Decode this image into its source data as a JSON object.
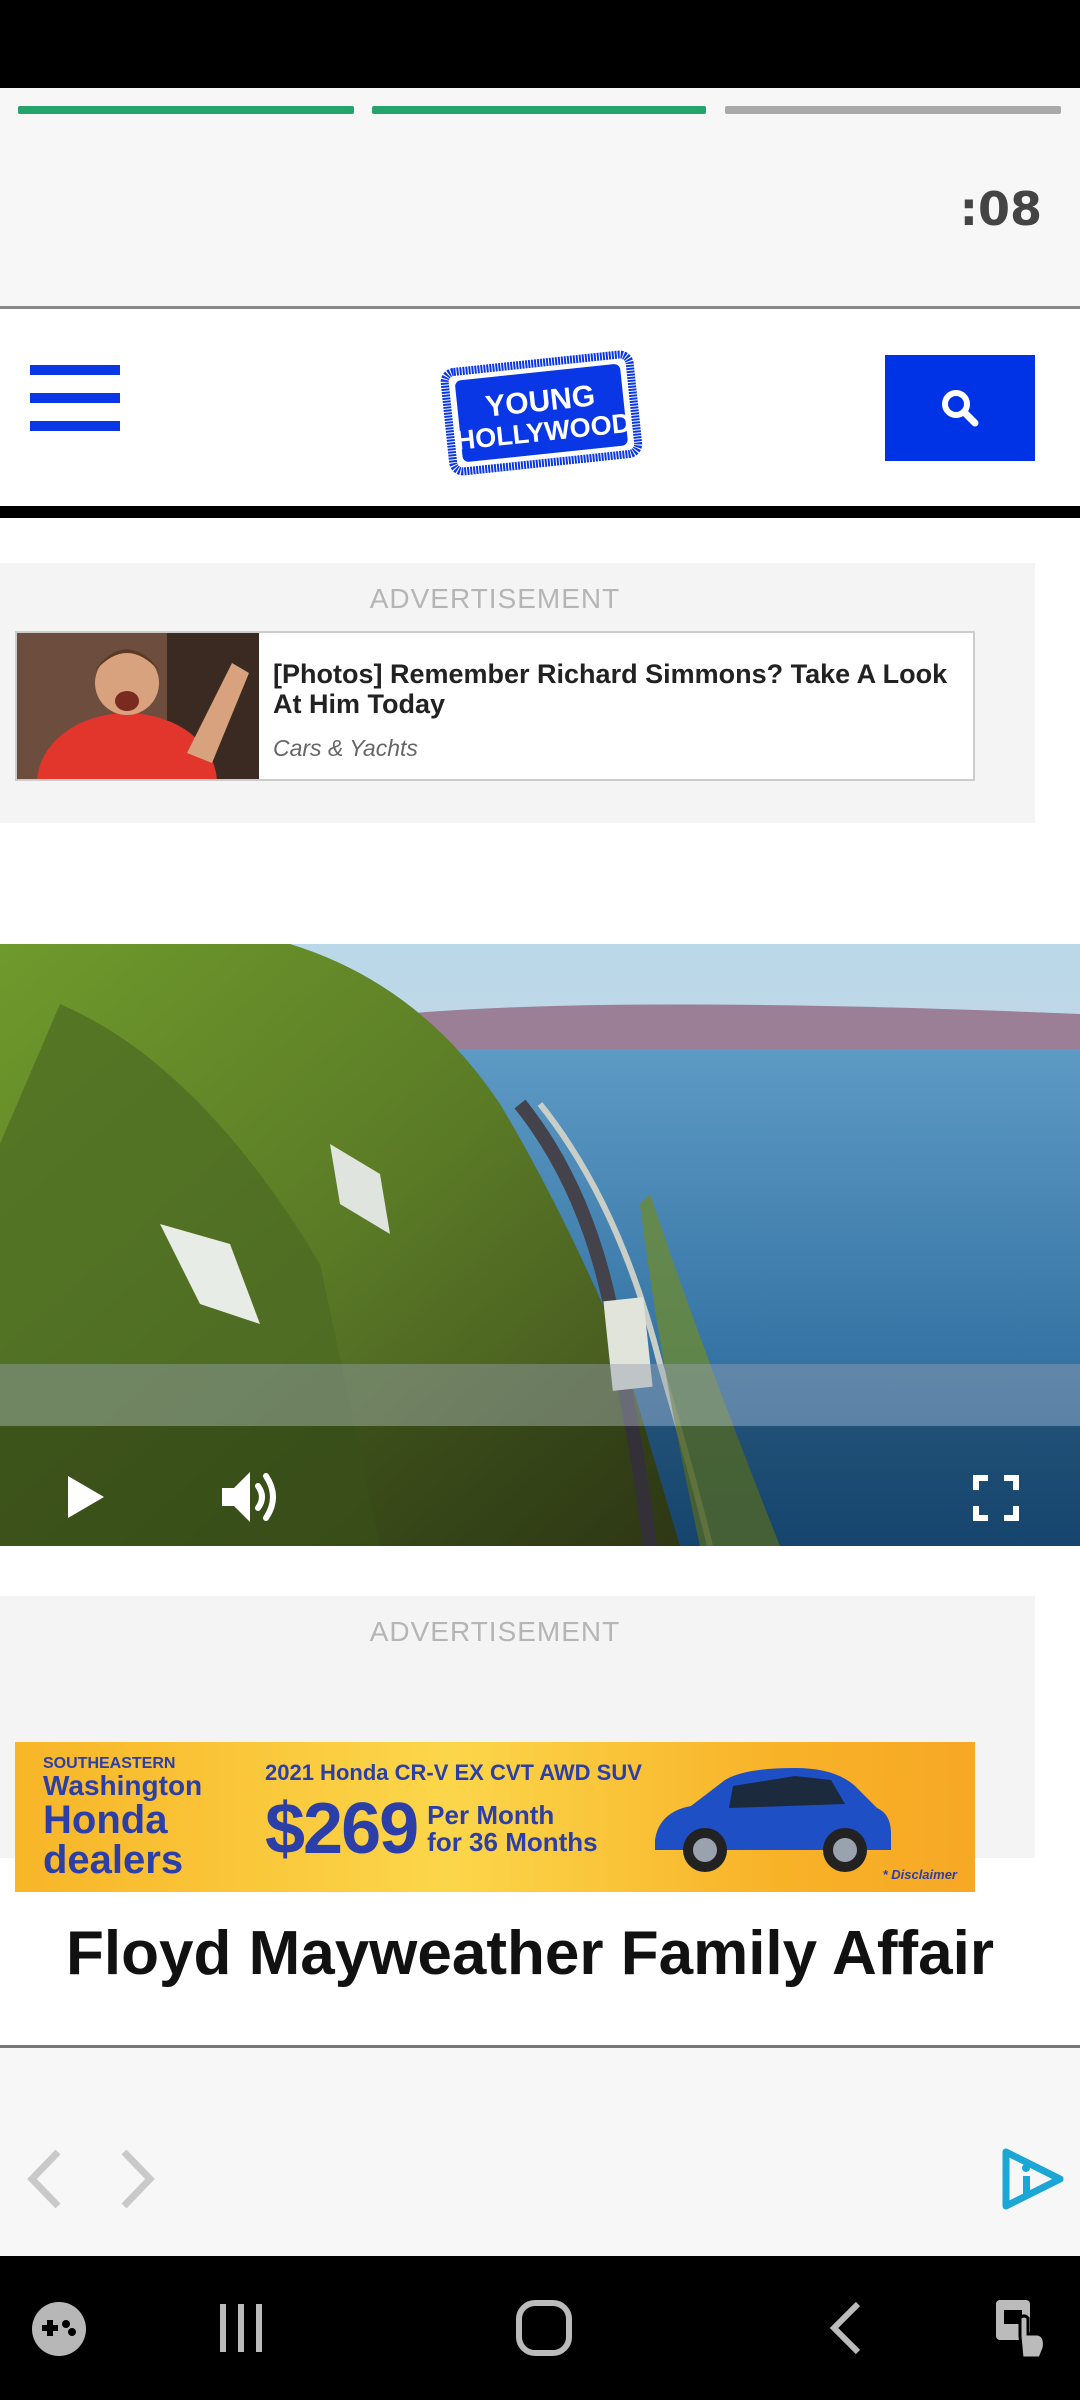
{
  "story": {
    "timer": ":08",
    "segments": [
      {
        "state": "watched",
        "color": "#24a36b"
      },
      {
        "state": "watched",
        "color": "#24a36b"
      },
      {
        "state": "pending",
        "color": "#a9a9a9"
      }
    ]
  },
  "header": {
    "logo_line1": "YOUNG",
    "logo_line2": "HOLLYWOOD",
    "brand_color": "#0a37e6",
    "menu_icon": "hamburger-menu-icon",
    "search_icon": "search-icon"
  },
  "ad1": {
    "label": "ADVERTISEMENT",
    "title": "[Photos] Remember Richard Simmons? Take A Look At Him Today",
    "source": "Cars & Yachts"
  },
  "video": {
    "controls": [
      "play-icon",
      "volume-icon",
      "fullscreen-icon"
    ]
  },
  "ad2": {
    "label": "ADVERTISEMENT",
    "brand_line1": "SOUTHEASTERN",
    "brand_line2": "Washington",
    "brand_line3": "Honda",
    "brand_line4": "dealers",
    "model": "2021 Honda CR-V EX CVT AWD SUV",
    "price": "$269",
    "terms_line1": "Per Month",
    "terms_line2": "for 36 Months",
    "disclaimer": "* Disclaimer"
  },
  "article": {
    "headline": "Floyd Mayweather Family Affair"
  },
  "footer": {
    "icons": [
      "chevron-left-icon",
      "chevron-right-icon",
      "adchoices-icon"
    ]
  },
  "system_nav": {
    "icons": [
      "game-launcher-icon",
      "recents-icon",
      "home-icon",
      "back-icon",
      "accessibility-icon"
    ]
  }
}
